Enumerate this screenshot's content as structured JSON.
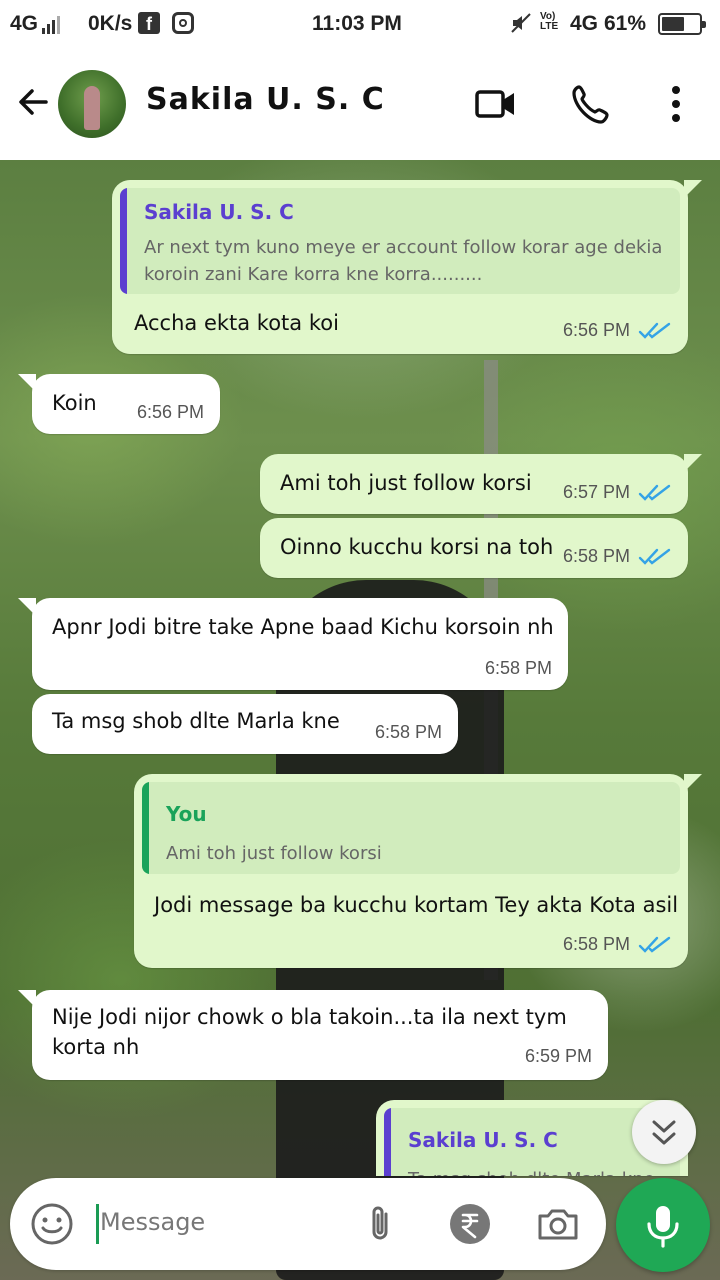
{
  "status_bar": {
    "network_left": "4G",
    "speed": "0K/s",
    "time": "11:03 PM",
    "volte": "Vo) LTE",
    "network_right": "4G",
    "battery": "61%",
    "battery_level": 0.61
  },
  "header": {
    "contact_name": "Sakila U. S. C",
    "icons": [
      "back-arrow-icon",
      "video-call-icon",
      "voice-call-icon",
      "more-options-icon"
    ]
  },
  "messages": [
    {
      "dir": "out",
      "quote": {
        "name": "Sakila U. S. C",
        "text_lines": [
          "Ar next tym kuno meye er account follow korar age dekia",
          "koroin zani Kare korra kne korra........."
        ]
      },
      "lines": [
        "Accha ekta kota koi"
      ],
      "time": "6:56 PM",
      "read": true
    },
    {
      "dir": "in",
      "lines": [
        "Koin"
      ],
      "time": "6:56 PM"
    },
    {
      "dir": "out",
      "lines": [
        "Ami toh just follow korsi"
      ],
      "time": "6:57 PM",
      "read": true
    },
    {
      "dir": "out",
      "lines": [
        "Oinno kucchu korsi na toh"
      ],
      "time": "6:58 PM",
      "read": true
    },
    {
      "dir": "in",
      "lines": [
        "Apnr Jodi bitre take Apne baad Kichu korsoin nh"
      ],
      "time": "6:58 PM"
    },
    {
      "dir": "in",
      "lines": [
        "Ta msg shob dlte Marla kne"
      ],
      "time": "6:58 PM"
    },
    {
      "dir": "out",
      "quote": {
        "name": "You",
        "text_lines": [
          "Ami toh just follow korsi"
        ]
      },
      "lines": [
        "Jodi message ba kucchu kortam Tey akta Kota asil"
      ],
      "time": "6:58 PM",
      "read": true
    },
    {
      "dir": "in",
      "lines": [
        "Nije Jodi nijor chowk o bla takoin...ta ila next tym",
        "korta nh"
      ],
      "time": "6:59 PM"
    },
    {
      "dir": "out",
      "quote": {
        "name": "Sakila U. S. C",
        "text_lines": [
          "Ta msg shob dlte Marla kne"
        ]
      },
      "lines": [],
      "time": "",
      "read": false
    }
  ],
  "composer": {
    "placeholder": "Message",
    "icons": [
      "emoji-icon",
      "attach-icon",
      "payment-rupee-icon",
      "camera-icon",
      "mic-icon"
    ]
  },
  "colors": {
    "outgoing_bubble": "#e1f7cb",
    "incoming_bubble": "#ffffff",
    "quote_sakila": "#5b3fd0",
    "quote_you": "#1aa35a",
    "read_ticks": "#34a3e6",
    "accent_green": "#1fa855"
  }
}
